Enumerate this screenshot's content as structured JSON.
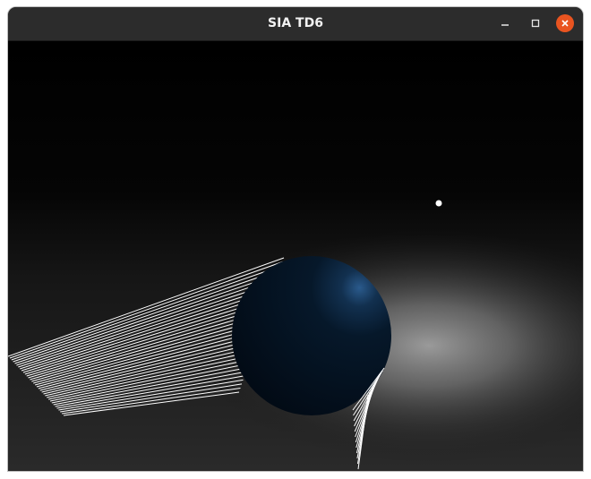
{
  "window": {
    "title": "SIA TD6",
    "buttons": {
      "minimize_icon": "minimize-icon",
      "maximize_icon": "maximize-icon",
      "close_icon": "close-icon"
    },
    "colors": {
      "titlebar": "#2c2c2c",
      "close_button": "#e95420",
      "title_text": "#f2f2f2"
    }
  },
  "scene": {
    "background": "#000000",
    "floor_highlight": "#9a9a9a",
    "sphere_color": "#04101c",
    "sphere_rim": "#2a5a8c",
    "light_color": "#ffffff",
    "line_color": "#ffffff"
  }
}
